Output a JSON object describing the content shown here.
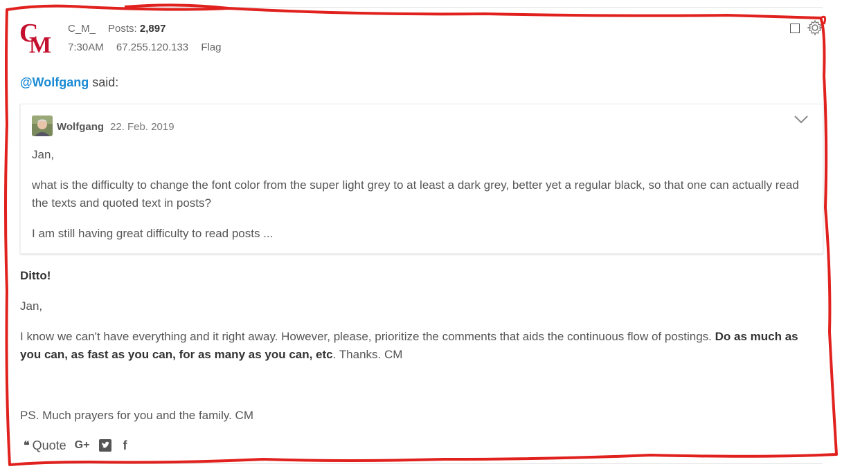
{
  "post": {
    "username": "C_M_",
    "posts_label": "Posts:",
    "posts_count": "2,897",
    "time": "7:30AM",
    "ip": "67.255.120.133",
    "flag_label": "Flag",
    "avatar_letters": "CM"
  },
  "reply": {
    "mention": "@Wolfgang",
    "said": " said:"
  },
  "quote": {
    "author": "Wolfgang",
    "date": "22. Feb. 2019",
    "paragraphs": [
      "Jan,",
      "what is the difficulty to change the font color from the super light grey to at least a dark grey, better yet a regular black, so that one can actually read the texts and quoted text in posts?",
      "I am still having great difficulty to read posts ..."
    ]
  },
  "body": {
    "ditto": "Ditto!",
    "greeting": "Jan,",
    "main_plain": "I know we can't have everything and it right away. However, please, prioritize the comments that aids the continuous flow of postings. ",
    "main_bold": "Do as much as you can, as fast as you can, for as many as you can, etc",
    "main_tail": ". Thanks. CM",
    "ps": "PS. Much prayers for you and the family. CM"
  },
  "actions": {
    "quote_icon": "quote-icon",
    "quote_label": "Quote",
    "gplus_icon": "google-plus-icon",
    "gplus_glyph": "G+",
    "twitter_icon": "twitter-icon",
    "facebook_icon": "facebook-icon",
    "facebook_glyph": "f"
  },
  "colors": {
    "mention": "#1a8ad4",
    "avatar_red": "#c4102e",
    "annotation_red": "#e0211d"
  }
}
